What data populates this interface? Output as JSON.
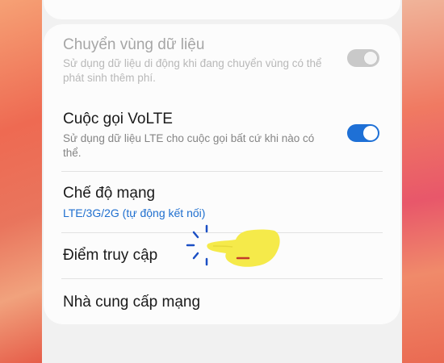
{
  "settings": {
    "items": [
      {
        "title": "Chuyển vùng dữ liệu",
        "subtitle": "Sử dụng dữ liệu di động khi đang chuyển vùng có thể phát sinh thêm phí.",
        "toggle": "off",
        "enabled": false
      },
      {
        "title": "Cuộc gọi VoLTE",
        "subtitle": "Sử dụng dữ liệu LTE cho cuộc gọi bất cứ khi nào có thể.",
        "toggle": "on",
        "enabled": true
      },
      {
        "title": "Chế độ mạng",
        "value": "LTE/3G/2G (tự động kết nối)"
      },
      {
        "title": "Điểm truy cập"
      },
      {
        "title": "Nhà cung cấp mạng"
      }
    ]
  },
  "colors": {
    "accent": "#1e70d6",
    "toggle_off": "#c9c9c9",
    "hand": "#f5ea4a"
  },
  "icons": {
    "tap_hand": "pointing-hand-icon"
  }
}
